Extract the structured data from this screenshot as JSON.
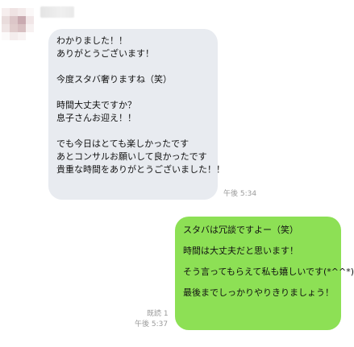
{
  "incoming": {
    "time": "午後 5:34",
    "lines": [
      "わかりました！！",
      "ありがとうございます！",
      "",
      "今度スタバ奢りますね（笑）",
      "",
      "時間大丈夫ですか？",
      "息子さんお迎え！！",
      "",
      "でも今日はとても楽しかったです",
      "あとコンサルお願いして良かったです",
      "貴重な時間をありがとうございました！！"
    ]
  },
  "outgoing": {
    "read_label": "既読 1",
    "time": "午後 5:37",
    "lines": [
      "スタバは冗談ですよー（笑）",
      "時間は大丈夫だと思います！",
      "そう言ってもらえて私も嬉しいです(*^^*)",
      "最後までしっかりやりきりましょう！"
    ]
  },
  "colors": {
    "incoming_bubble": "#e8ebf0",
    "outgoing_bubble": "#8de055",
    "meta_text": "#9a9a9a"
  }
}
